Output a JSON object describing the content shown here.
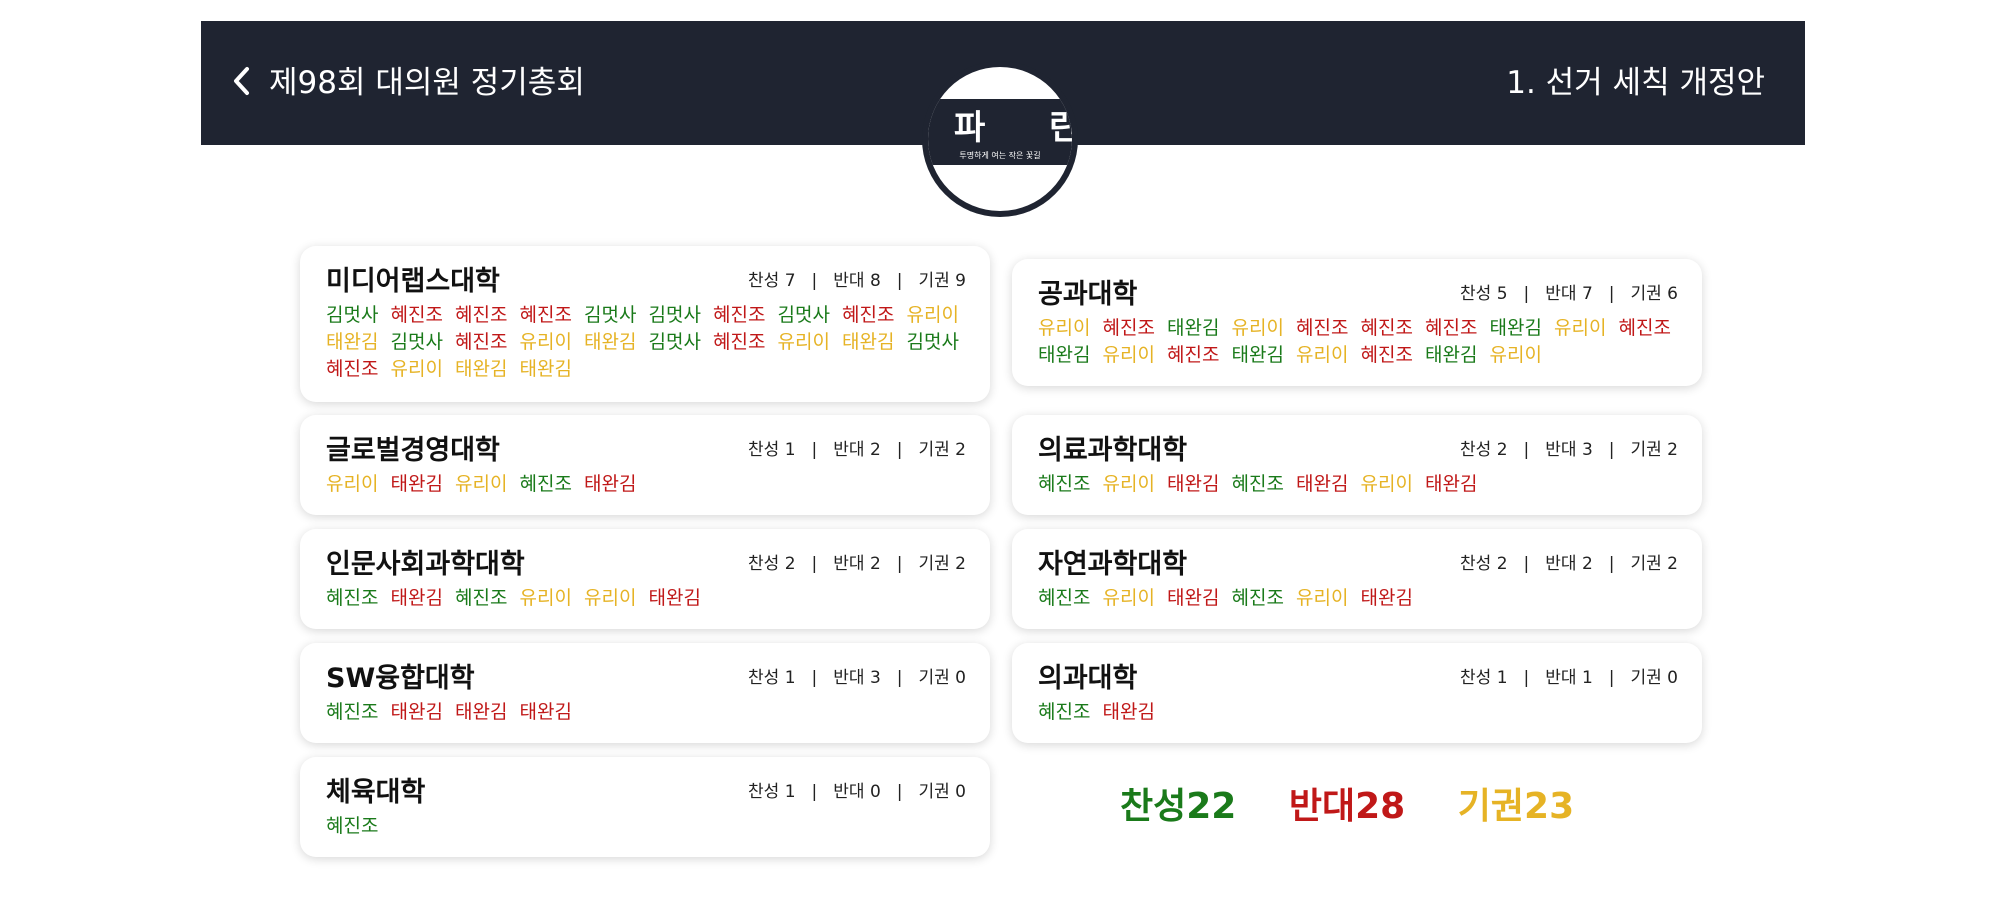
{
  "colors": {
    "header_bg": "#1f2431",
    "for": "#1a7a1a",
    "against": "#c01818",
    "abstain": "#e6b325"
  },
  "header": {
    "back_icon": "chevron-left-icon",
    "meeting_title": "제98회 대의원 정기총회",
    "agenda_title": "1. 선거 세칙 개정안"
  },
  "logo": {
    "text": "파 란",
    "slogan": "투명하게 여는 작은 꽃길"
  },
  "tally_labels": {
    "for": "찬성",
    "against": "반대",
    "abstain": "기권",
    "separator": "|"
  },
  "colleges": [
    {
      "name": "미디어랩스대학",
      "for": "찬성 7",
      "against": "반대 8",
      "abstain": "기권 9",
      "voters": [
        {
          "name": "김멋사",
          "vote": "for"
        },
        {
          "name": "혜진조",
          "vote": "against"
        },
        {
          "name": "혜진조",
          "vote": "against"
        },
        {
          "name": "혜진조",
          "vote": "against"
        },
        {
          "name": "김멋사",
          "vote": "for"
        },
        {
          "name": "김멋사",
          "vote": "for"
        },
        {
          "name": "혜진조",
          "vote": "against"
        },
        {
          "name": "김멋사",
          "vote": "for"
        },
        {
          "name": "혜진조",
          "vote": "against"
        },
        {
          "name": "유리이",
          "vote": "abstain"
        },
        {
          "name": "태완김",
          "vote": "abstain"
        },
        {
          "name": "김멋사",
          "vote": "for"
        },
        {
          "name": "혜진조",
          "vote": "against"
        },
        {
          "name": "유리이",
          "vote": "abstain"
        },
        {
          "name": "태완김",
          "vote": "abstain"
        },
        {
          "name": "김멋사",
          "vote": "for"
        },
        {
          "name": "혜진조",
          "vote": "against"
        },
        {
          "name": "유리이",
          "vote": "abstain"
        },
        {
          "name": "태완김",
          "vote": "abstain"
        },
        {
          "name": "김멋사",
          "vote": "for"
        },
        {
          "name": "혜진조",
          "vote": "against"
        },
        {
          "name": "유리이",
          "vote": "abstain"
        },
        {
          "name": "태완김",
          "vote": "abstain"
        },
        {
          "name": "태완김",
          "vote": "abstain"
        }
      ]
    },
    {
      "name": "공과대학",
      "for": "찬성 5",
      "against": "반대 7",
      "abstain": "기권 6",
      "voters": [
        {
          "name": "유리이",
          "vote": "abstain"
        },
        {
          "name": "혜진조",
          "vote": "against"
        },
        {
          "name": "태완김",
          "vote": "for"
        },
        {
          "name": "유리이",
          "vote": "abstain"
        },
        {
          "name": "혜진조",
          "vote": "against"
        },
        {
          "name": "혜진조",
          "vote": "against"
        },
        {
          "name": "혜진조",
          "vote": "against"
        },
        {
          "name": "태완김",
          "vote": "for"
        },
        {
          "name": "유리이",
          "vote": "abstain"
        },
        {
          "name": "혜진조",
          "vote": "against"
        },
        {
          "name": "태완김",
          "vote": "for"
        },
        {
          "name": "유리이",
          "vote": "abstain"
        },
        {
          "name": "혜진조",
          "vote": "against"
        },
        {
          "name": "태완김",
          "vote": "for"
        },
        {
          "name": "유리이",
          "vote": "abstain"
        },
        {
          "name": "혜진조",
          "vote": "against"
        },
        {
          "name": "태완김",
          "vote": "for"
        },
        {
          "name": "유리이",
          "vote": "abstain"
        }
      ]
    },
    {
      "name": "글로벌경영대학",
      "for": "찬성 1",
      "against": "반대 2",
      "abstain": "기권 2",
      "voters": [
        {
          "name": "유리이",
          "vote": "abstain"
        },
        {
          "name": "태완김",
          "vote": "against"
        },
        {
          "name": "유리이",
          "vote": "abstain"
        },
        {
          "name": "혜진조",
          "vote": "for"
        },
        {
          "name": "태완김",
          "vote": "against"
        }
      ]
    },
    {
      "name": "의료과학대학",
      "for": "찬성 2",
      "against": "반대 3",
      "abstain": "기권 2",
      "voters": [
        {
          "name": "혜진조",
          "vote": "for"
        },
        {
          "name": "유리이",
          "vote": "abstain"
        },
        {
          "name": "태완김",
          "vote": "against"
        },
        {
          "name": "혜진조",
          "vote": "for"
        },
        {
          "name": "태완김",
          "vote": "against"
        },
        {
          "name": "유리이",
          "vote": "abstain"
        },
        {
          "name": "태완김",
          "vote": "against"
        }
      ]
    },
    {
      "name": "인문사회과학대학",
      "for": "찬성 2",
      "against": "반대 2",
      "abstain": "기권 2",
      "voters": [
        {
          "name": "혜진조",
          "vote": "for"
        },
        {
          "name": "태완김",
          "vote": "against"
        },
        {
          "name": "혜진조",
          "vote": "for"
        },
        {
          "name": "유리이",
          "vote": "abstain"
        },
        {
          "name": "유리이",
          "vote": "abstain"
        },
        {
          "name": "태완김",
          "vote": "against"
        }
      ]
    },
    {
      "name": "자연과학대학",
      "for": "찬성 2",
      "against": "반대 2",
      "abstain": "기권 2",
      "voters": [
        {
          "name": "혜진조",
          "vote": "for"
        },
        {
          "name": "유리이",
          "vote": "abstain"
        },
        {
          "name": "태완김",
          "vote": "against"
        },
        {
          "name": "혜진조",
          "vote": "for"
        },
        {
          "name": "유리이",
          "vote": "abstain"
        },
        {
          "name": "태완김",
          "vote": "against"
        }
      ]
    },
    {
      "name": "SW융합대학",
      "for": "찬성 1",
      "against": "반대 3",
      "abstain": "기권 0",
      "voters": [
        {
          "name": "혜진조",
          "vote": "for"
        },
        {
          "name": "태완김",
          "vote": "against"
        },
        {
          "name": "태완김",
          "vote": "against"
        },
        {
          "name": "태완김",
          "vote": "against"
        }
      ]
    },
    {
      "name": "의과대학",
      "for": "찬성 1",
      "against": "반대 1",
      "abstain": "기권 0",
      "voters": [
        {
          "name": "혜진조",
          "vote": "for"
        },
        {
          "name": "태완김",
          "vote": "against"
        }
      ]
    },
    {
      "name": "체육대학",
      "for": "찬성 1",
      "against": "반대 0",
      "abstain": "기권 0",
      "voters": [
        {
          "name": "혜진조",
          "vote": "for"
        }
      ]
    }
  ],
  "totals": {
    "for": "찬성22",
    "against": "반대28",
    "abstain": "기권23"
  }
}
